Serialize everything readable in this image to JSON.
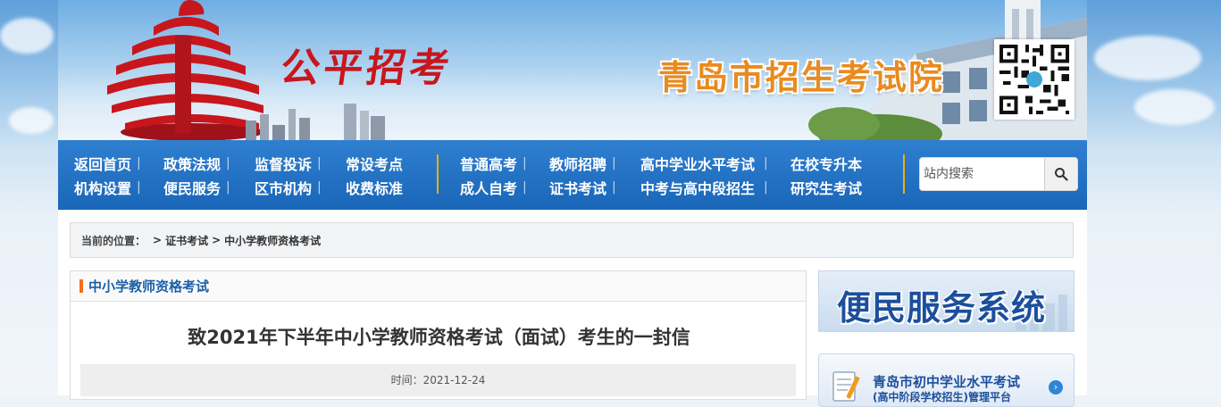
{
  "banner": {
    "slogan": "公平招考",
    "org_name": "青岛市招生考试院",
    "qr_label": "qr-code"
  },
  "nav": {
    "group1": [
      [
        "返回首页",
        "政策法规",
        "监督投诉",
        "常设考点"
      ],
      [
        "机构设置",
        "便民服务",
        "区市机构",
        "收费标准"
      ]
    ],
    "group2": [
      [
        "普通高考",
        "教师招聘",
        "高中学业水平考试",
        "在校专升本"
      ],
      [
        "成人自考",
        "证书考试",
        "中考与高中段招生",
        "研究生考试"
      ]
    ],
    "search_placeholder": "站内搜索",
    "search_icon": "search-icon"
  },
  "breadcrumb": {
    "label": "当前的位置：",
    "sep1": ">",
    "item1": "证书考试",
    "sep2": ">",
    "item2": "中小学教师资格考试"
  },
  "panel": {
    "title": "中小学教师资格考试",
    "article_title": "致2021年下半年中小学教师资格考试（面试）考生的一封信",
    "date_label": "时间：2021-12-24"
  },
  "sidebar": {
    "banner_text": "便民服务系统",
    "link_title": "青岛市初中学业水平考试",
    "link_sub": "(高中阶段学校招生)管理平台"
  },
  "colors": {
    "nav_bg": "#1a66b8",
    "accent_orange": "#f36f21",
    "link_blue": "#1a5fa8",
    "divider_gold": "#f0b000"
  }
}
